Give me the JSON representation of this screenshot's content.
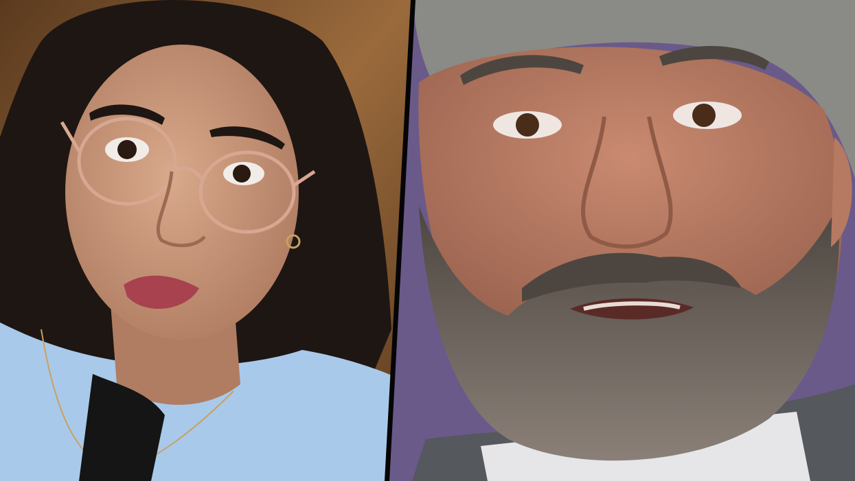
{
  "image": {
    "layout": "split-diptych",
    "divider_color": "#050505",
    "left_panel": {
      "subject": "woman-portrait-glasses",
      "palette": {
        "background": "#9a6a3c",
        "background_dark": "#5a3a1e",
        "hair": "#1e1612",
        "skin": "#d9a98b",
        "skin_shadow": "#b07d62",
        "lips": "#a8424e",
        "glasses_frame": "#d8a792",
        "clothing": "#a9c9ea",
        "microphone": "#151515"
      }
    },
    "right_panel": {
      "subject": "man-closeup-beard",
      "palette": {
        "background": "#6a5a8a",
        "skin": "#c98a70",
        "skin_shadow": "#9c6450",
        "beard": "#8a8078",
        "beard_dark": "#4d4640",
        "hair": "#8a8a86",
        "eyes": "#4a2c1a",
        "suit": "#55585c",
        "shirt": "#e6e6e8"
      }
    }
  }
}
